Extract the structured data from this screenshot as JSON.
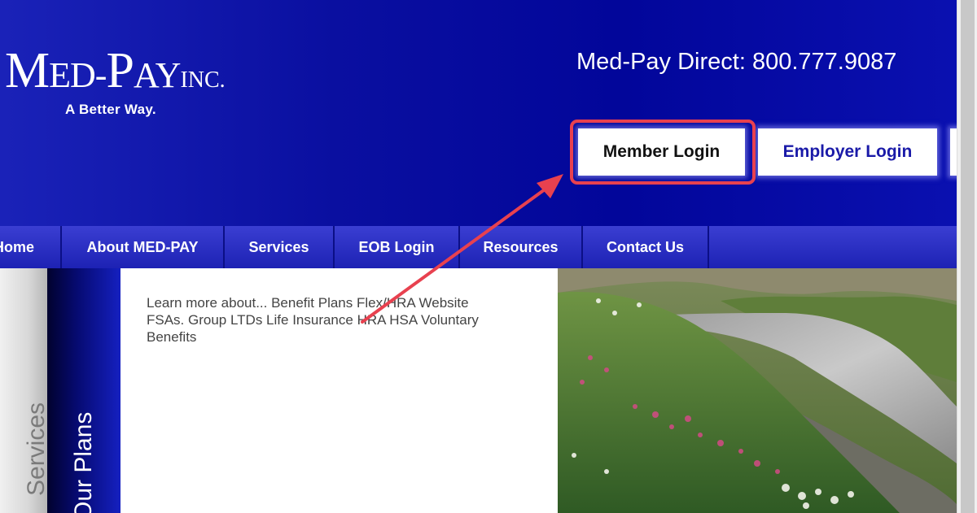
{
  "header": {
    "logo_big_m": "M",
    "logo_ed": "ED-",
    "logo_big_p": "P",
    "logo_ay": "AY",
    "logo_inc": "INC.",
    "tagline": "A Better Way.",
    "phone": "Med-Pay Direct: 800.777.9087",
    "member_login": "Member Login",
    "employer_login": "Employer Login"
  },
  "nav": {
    "items": [
      {
        "label": "Home"
      },
      {
        "label": "About MED-PAY"
      },
      {
        "label": "Services"
      },
      {
        "label": "EOB Login"
      },
      {
        "label": "Resources"
      },
      {
        "label": "Contact Us"
      }
    ]
  },
  "sidebar": {
    "gray_label": "Services",
    "blue_label": "Our Plans"
  },
  "content": {
    "text": "Learn more about... Benefit Plans Flex/HRA Website FSAs. Group LTDs Life Insurance HRA HSA Voluntary Benefits"
  },
  "annotation": {
    "highlight_color": "#e8414f"
  },
  "colors": {
    "header_blue": "#02069a",
    "nav_blue": "#2a2ec4",
    "employer_text": "#1a1aa8"
  }
}
